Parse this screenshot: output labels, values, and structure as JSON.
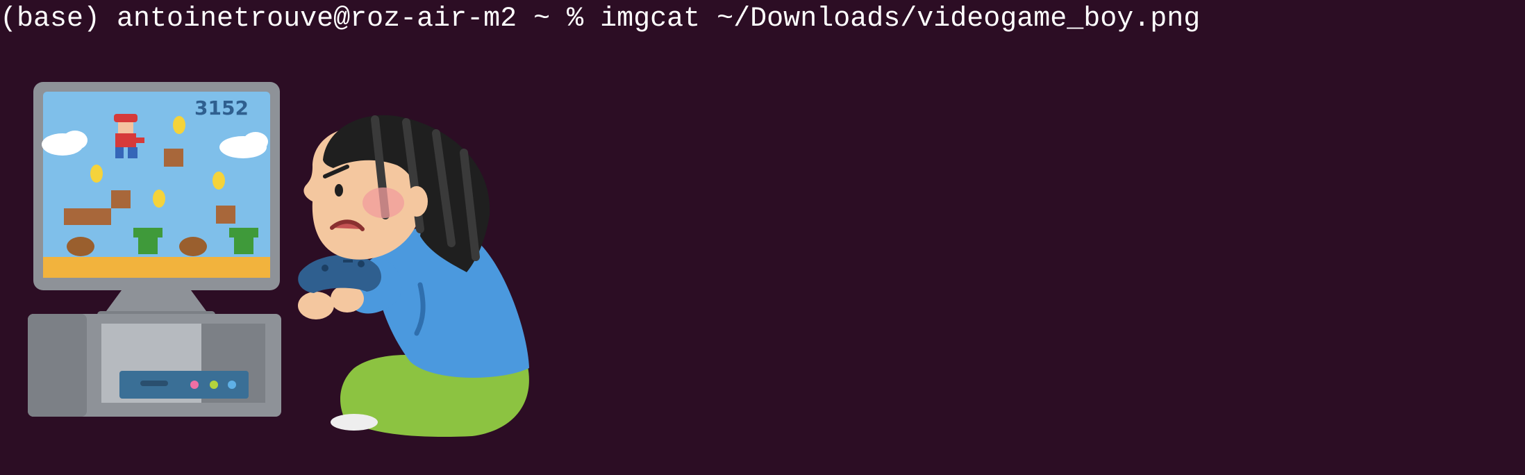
{
  "terminal": {
    "prompt": "(base) antoinetrouve@roz-air-m2 ~ % ",
    "command": "imgcat ~/Downloads/videogame_boy.png"
  },
  "image": {
    "score": "3152"
  },
  "colors": {
    "background": "#2c0d24",
    "text": "#ffffff"
  }
}
